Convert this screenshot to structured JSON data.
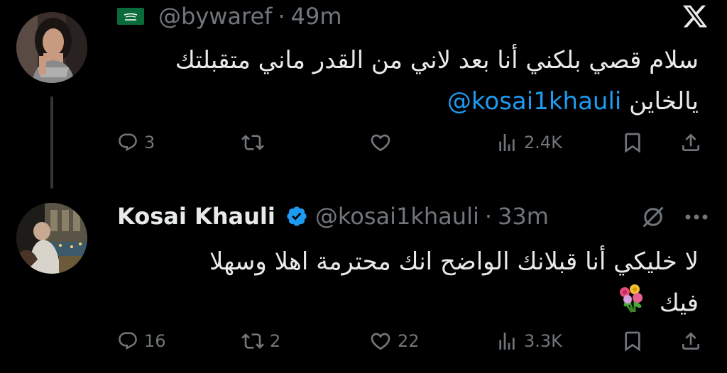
{
  "colors": {
    "background": "#000000",
    "text": "#e7e9ea",
    "muted": "#71767b",
    "accent": "#1d9bf0",
    "thread_line": "#333639"
  },
  "tweets": [
    {
      "flag_icon": "saudi-flag-icon",
      "handle": "@bywaref",
      "separator": "·",
      "time": "49m",
      "text_line1": "سلام قصي بلكني أنا بعد لاني من القدر ماني متقبلتك",
      "text_line2_prefix": "يالخاين",
      "mention": "@kosai1khauli",
      "actions": {
        "replies": "3",
        "retweets": "",
        "likes": "",
        "views": "2.4K"
      }
    },
    {
      "display_name": "Kosai Khauli",
      "handle": "@kosai1khauli",
      "separator": "·",
      "time": "33m",
      "text_line1": "لا خليكي أنا قبلانك  الواضح انك محترمة اهلا وسهلا",
      "text_line2": "فيك",
      "emoji": "bouquet-emoji",
      "actions": {
        "replies": "16",
        "retweets": "2",
        "likes": "22",
        "views": "3.3K"
      }
    }
  ]
}
